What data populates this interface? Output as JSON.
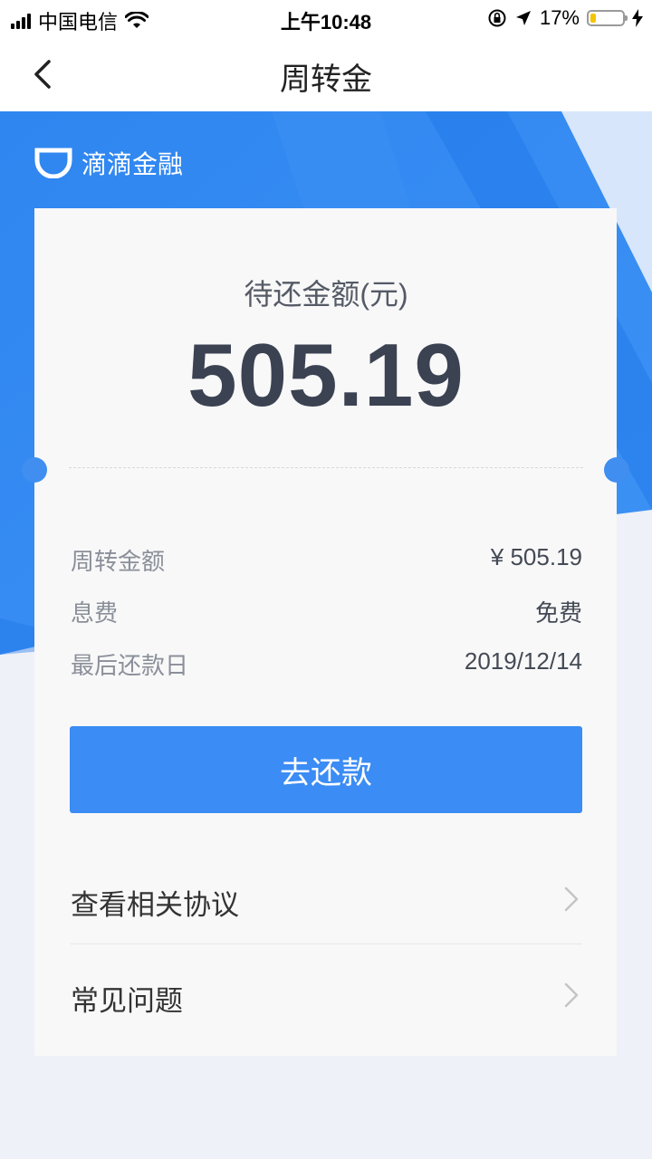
{
  "status_bar": {
    "carrier": "中国电信",
    "time": "上午10:48",
    "battery_percent_text": "17%",
    "battery_level": 0.17,
    "signal_bars": 4
  },
  "nav": {
    "title": "周转金",
    "back_icon": "chevron-left-icon"
  },
  "brand": {
    "name": "滴滴金融"
  },
  "summary": {
    "amount_label": "待还金额(元)",
    "amount_value": "505.19"
  },
  "details": [
    {
      "key": "周转金额",
      "value": "¥ 505.19"
    },
    {
      "key": "息费",
      "value": "免费"
    },
    {
      "key": "最后还款日",
      "value": "2019/12/14"
    }
  ],
  "actions": {
    "repay_label": "去还款"
  },
  "links": [
    {
      "label": "查看相关协议",
      "icon": "chevron-right-icon"
    },
    {
      "label": "常见问题",
      "icon": "chevron-right-icon"
    }
  ],
  "colors": {
    "primary_blue": "#3b8cf4",
    "hero_blue": "#2f86f0",
    "background": "#eef1f8"
  }
}
